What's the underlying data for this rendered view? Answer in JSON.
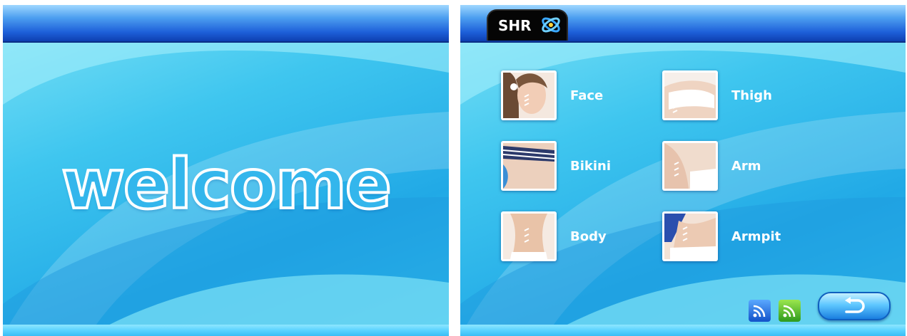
{
  "welcome_screen": {
    "title": "welcome"
  },
  "menu_screen": {
    "brand": "SHR",
    "brand_icon": "shr-logo-icon",
    "items": [
      {
        "label": "Face",
        "icon": "face-thumbnail"
      },
      {
        "label": "Thigh",
        "icon": "thigh-thumbnail"
      },
      {
        "label": "Bikini",
        "icon": "bikini-thumbnail"
      },
      {
        "label": "Arm",
        "icon": "arm-thumbnail"
      },
      {
        "label": "Body",
        "icon": "body-thumbnail"
      },
      {
        "label": "Armpit",
        "icon": "armpit-thumbnail"
      }
    ],
    "signal_icons": [
      "signal-blue-icon",
      "signal-green-icon"
    ],
    "back_icon": "back-arrow-icon"
  },
  "colors": {
    "top_bar": "#1d5fd9",
    "background": "#3fc6ef",
    "text": "#ffffff"
  }
}
